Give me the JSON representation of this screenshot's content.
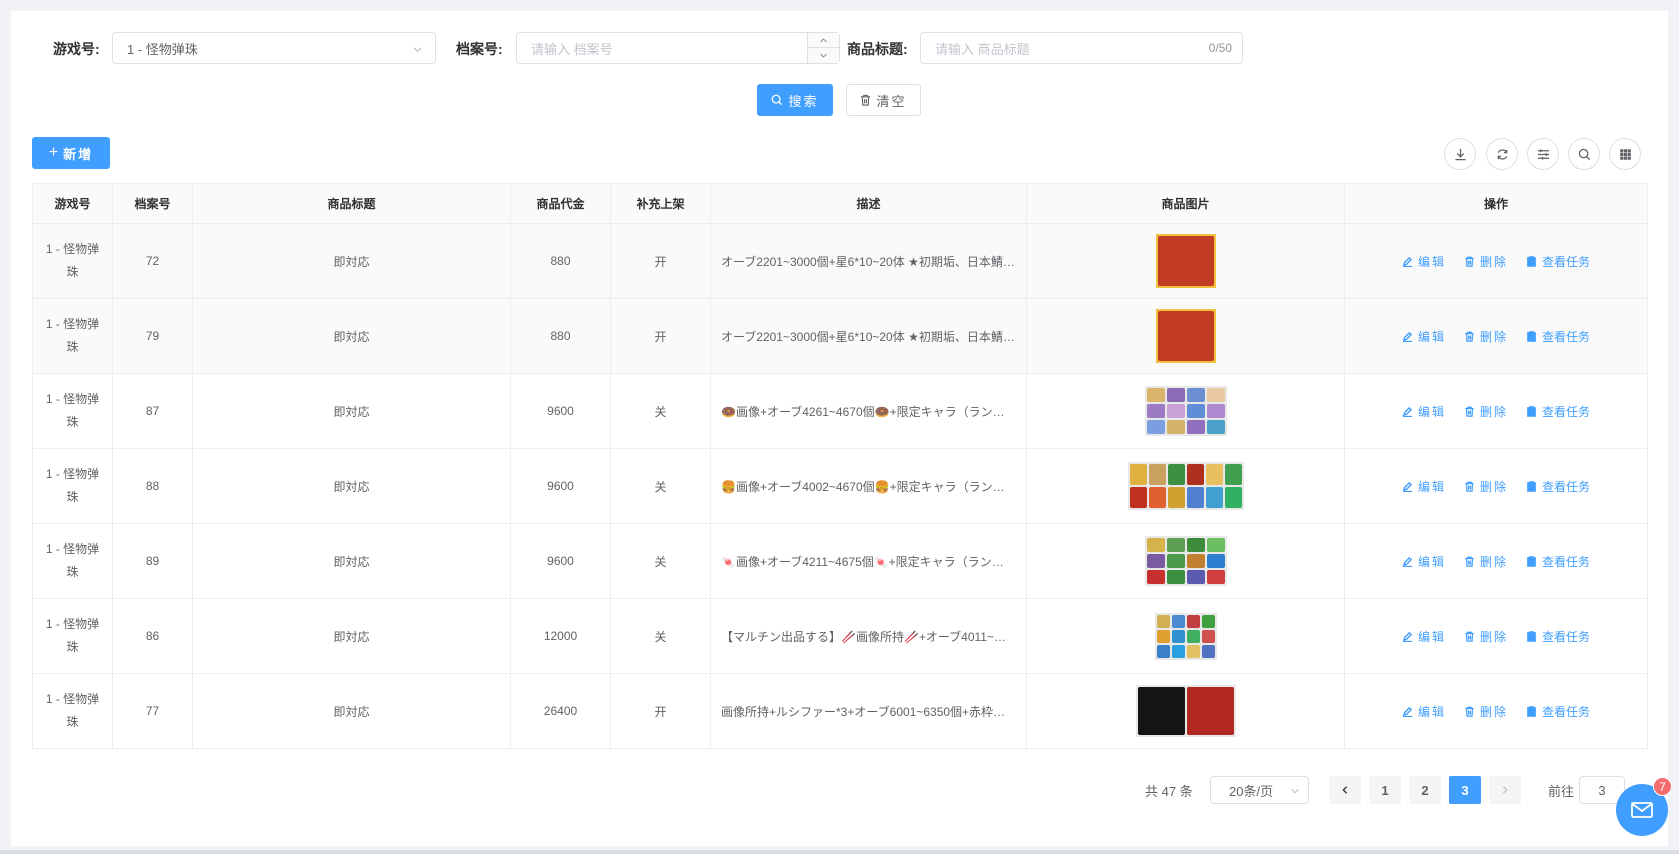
{
  "filters": {
    "game_label": "游戏号:",
    "game_value": "1 - 怪物弹珠",
    "archive_label": "档案号:",
    "archive_placeholder": "请输入 档案号",
    "title_label": "商品标题:",
    "title_placeholder": "请输入 商品标题",
    "title_counter": "0/50"
  },
  "actions": {
    "search": "搜索",
    "clear": "清空",
    "add": "新增"
  },
  "toolbar_icons": [
    "download-icon",
    "refresh-icon",
    "filter-settings-icon",
    "search-icon",
    "columns-grid-icon"
  ],
  "table": {
    "columns": [
      "游戏号",
      "档案号",
      "商品标题",
      "商品代金",
      "补充上架",
      "描述",
      "商品图片",
      "操作"
    ],
    "op_labels": {
      "edit": "编辑",
      "delete": "删除",
      "view": "查看任务"
    },
    "rows": [
      {
        "game": "1 - 怪物弹珠",
        "archive": "72",
        "title": "即対応",
        "price": "880",
        "restock": "开",
        "desc": "オーブ2201~3000個+星6*10~20体 ★初期垢、日本鯖…"
      },
      {
        "game": "1 - 怪物弹珠",
        "archive": "79",
        "title": "即対応",
        "price": "880",
        "restock": "开",
        "desc": "オーブ2201~3000個+星6*10~20体 ★初期垢、日本鯖…"
      },
      {
        "game": "1 - 怪物弹珠",
        "archive": "87",
        "title": "即対応",
        "price": "9600",
        "restock": "关",
        "desc": "🍩画像+オーブ4261~4670個🍩+限定キャラ（ラン…"
      },
      {
        "game": "1 - 怪物弹珠",
        "archive": "88",
        "title": "即対応",
        "price": "9600",
        "restock": "关",
        "desc": "🍔画像+オーブ4002~4670個🍔+限定キャラ（ラン…"
      },
      {
        "game": "1 - 怪物弹珠",
        "archive": "89",
        "title": "即対応",
        "price": "9600",
        "restock": "关",
        "desc": "🍬画像+オーブ4211~4675個🍬+限定キャラ（ラン…"
      },
      {
        "game": "1 - 怪物弹珠",
        "archive": "86",
        "title": "即対応",
        "price": "12000",
        "restock": "关",
        "desc": "【マルチン出品する】🥢画像所持🥢+オーブ4011~…"
      },
      {
        "game": "1 - 怪物弹珠",
        "archive": "77",
        "title": "即対応",
        "price": "26400",
        "restock": "开",
        "desc": "画像所持+ルシファー*3+オーブ6001~6350個+赤枠…"
      }
    ]
  },
  "pagination": {
    "total": "共 47 条",
    "page_size": "20条/页",
    "pages": [
      "1",
      "2",
      "3"
    ],
    "current": "3",
    "goto_label": "前往",
    "goto_value": "3"
  },
  "notification": {
    "count": "7"
  },
  "colors": {
    "primary": "#409eff",
    "badge": "#f56c6c",
    "border": "#dcdfe6"
  }
}
